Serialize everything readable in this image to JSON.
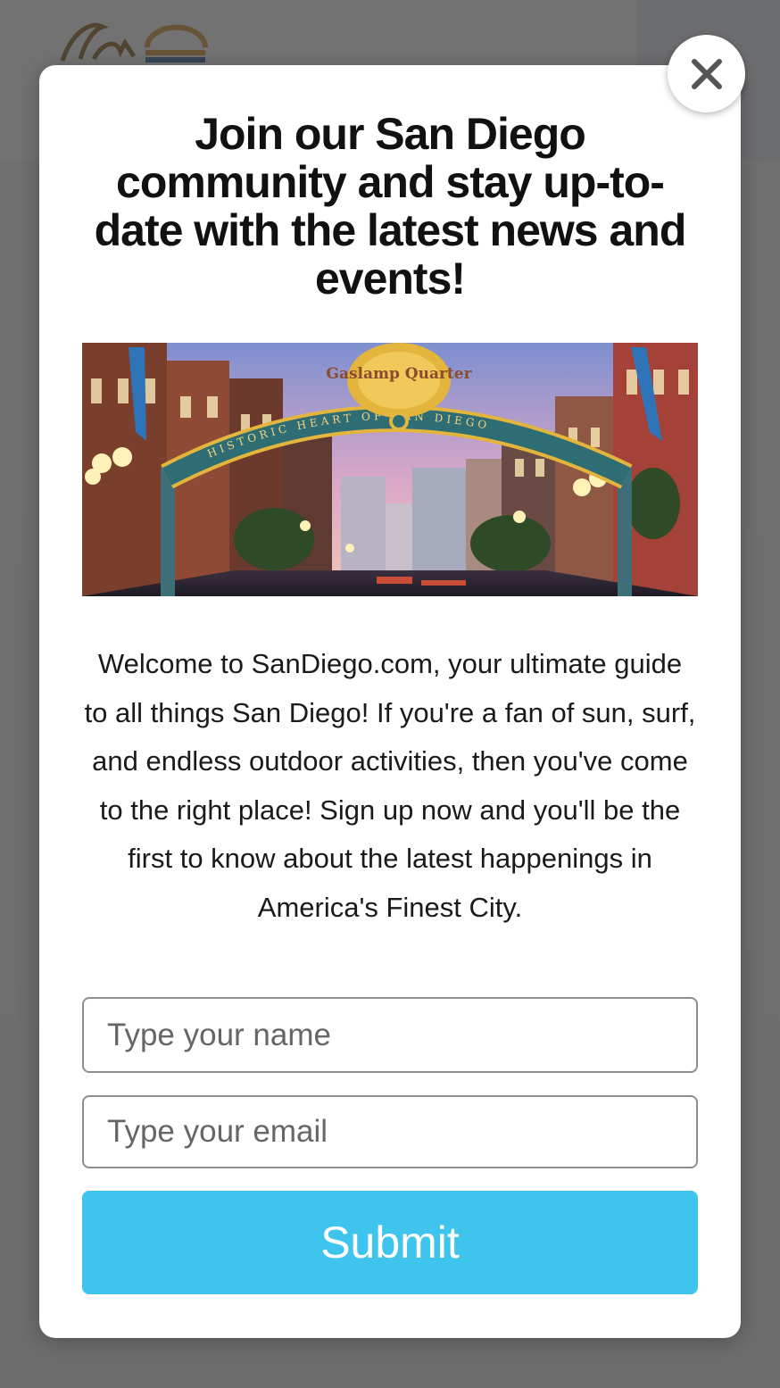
{
  "modal": {
    "title": "Join our San Diego community and stay up-to-date with the latest news and events!",
    "description": "Welcome to SanDiego.com, your ultimate guide to all things San Diego! If you're a fan of sun, surf, and endless outdoor activities, then you've come to the right place! Sign up now and you'll be the first to know about the latest happenings in America's Finest City.",
    "hero_image": {
      "sign_top_text": "Gaslamp Quarter",
      "sign_arch_text": "HISTORIC HEART OF SAN DIEGO"
    },
    "form": {
      "name_placeholder": "Type your name",
      "email_placeholder": "Type your email",
      "submit_label": "Submit"
    },
    "close_label": "×"
  },
  "colors": {
    "submit": "#3fc4ee",
    "overlay": "rgba(60,60,60,0.72)"
  },
  "icons": {
    "close": "close-icon",
    "logo": "site-logo"
  }
}
